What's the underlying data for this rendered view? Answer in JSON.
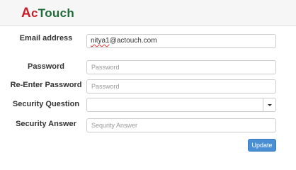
{
  "brand": {
    "logo_a": "A",
    "logo_c": "c",
    "logo_rest": "Touch"
  },
  "form": {
    "email": {
      "label": "Email address",
      "value_prefix": "nitya1",
      "value_suffix": "@actouch.com"
    },
    "password": {
      "label": "Password",
      "placeholder": "Password"
    },
    "reenter_password": {
      "label": "Re-Enter Password",
      "placeholder": "Password"
    },
    "security_question": {
      "label": "Security Question",
      "value": ""
    },
    "security_answer": {
      "label": "Security Answer",
      "placeholder": "Sequrity Answer"
    },
    "submit_label": "Update"
  },
  "colors": {
    "logo_red": "#c8202a",
    "logo_green": "#1f6b3a",
    "button_blue": "#4a8fd4"
  }
}
